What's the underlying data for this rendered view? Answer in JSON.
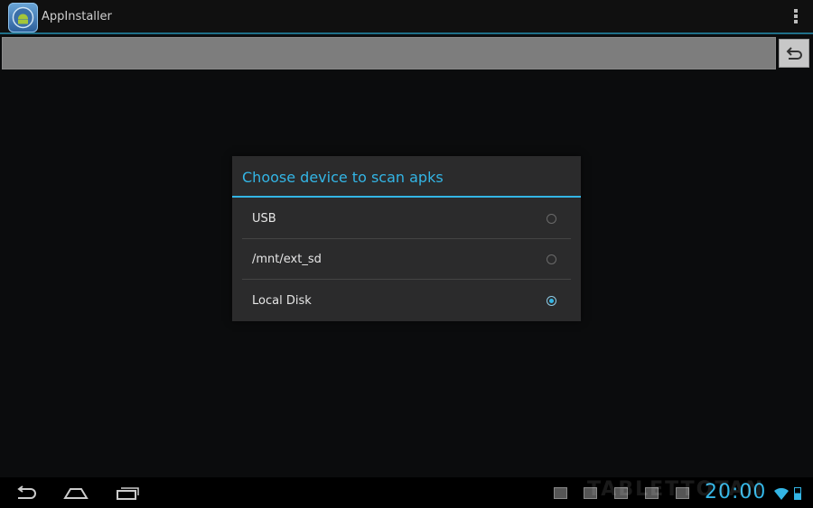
{
  "app": {
    "title": "AppInstaller"
  },
  "dialog": {
    "title": "Choose device to scan apks",
    "options": [
      {
        "label": "USB",
        "selected": false
      },
      {
        "label": "/mnt/ext_sd",
        "selected": false
      },
      {
        "label": "Local Disk",
        "selected": true
      }
    ]
  },
  "statusbar": {
    "time": "20:00",
    "watermark": "TABLETTOTAN"
  },
  "colors": {
    "accent": "#33b5e5",
    "background": "#0b0c0d",
    "dialog_bg": "#2b2b2c"
  },
  "icons": [
    "android-app-icon",
    "overflow-menu-icon",
    "up-folder-icon",
    "back-icon",
    "home-icon",
    "recent-apps-icon",
    "wifi-icon",
    "battery-icon"
  ]
}
